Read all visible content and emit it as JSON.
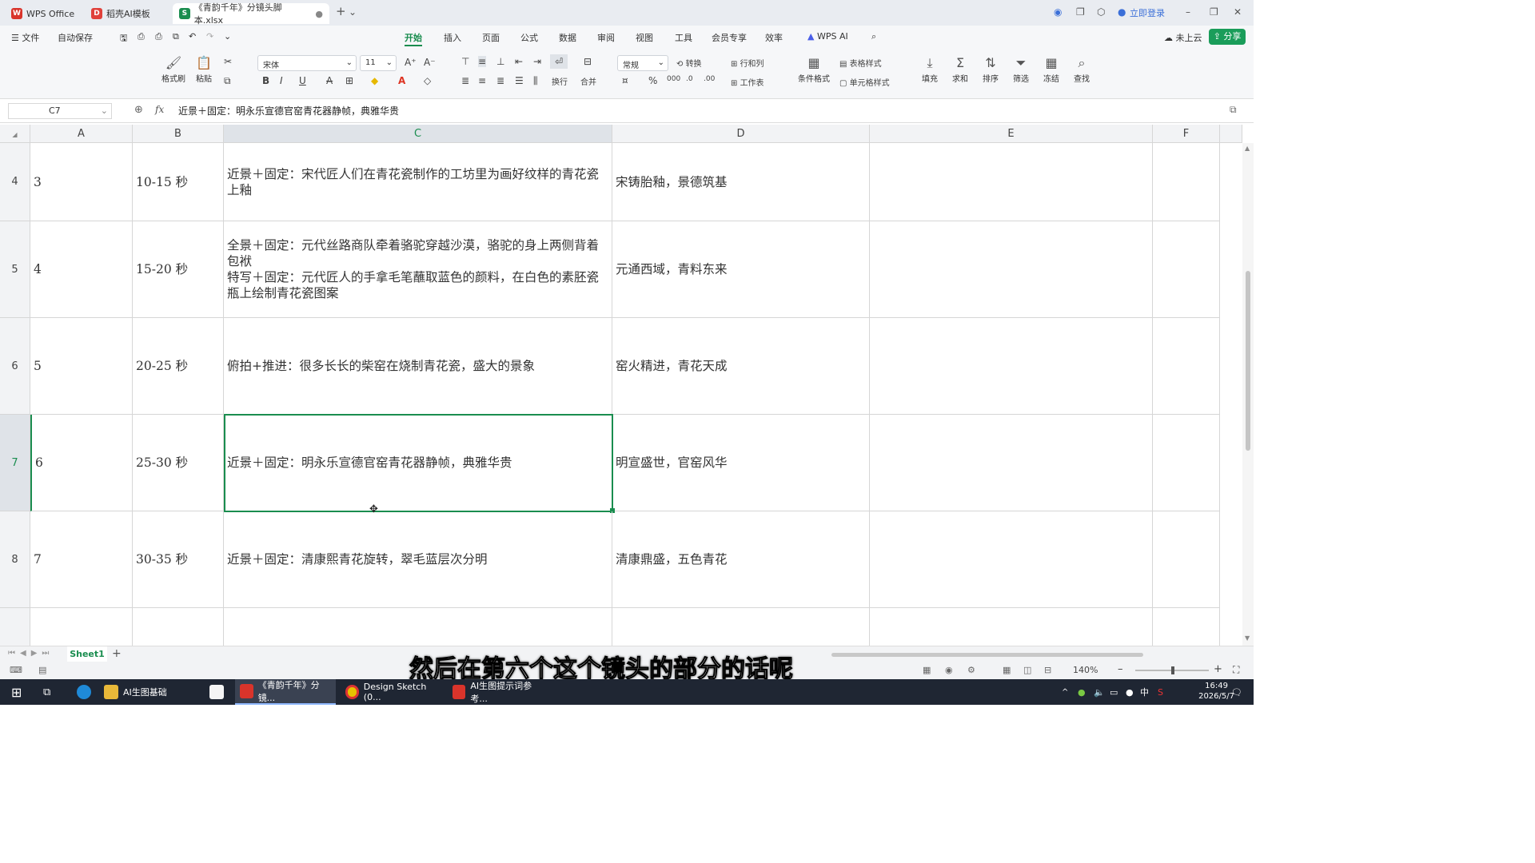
{
  "titlebar": {
    "tabs": [
      {
        "label": "WPS Office",
        "icon": "wps-icon"
      },
      {
        "label": "稻壳AI模板",
        "icon": "docer-icon"
      },
      {
        "label": "《青韵千年》分镜头脚本.xlsx",
        "icon": "sheet-icon"
      }
    ],
    "login": "立即登录"
  },
  "menubar": {
    "file": "文件",
    "autosave": "自动保存",
    "items": [
      "开始",
      "插入",
      "页面",
      "公式",
      "数据",
      "审阅",
      "视图",
      "工具",
      "会员专享",
      "效率"
    ],
    "wps_ai": "WPS AI",
    "cloud": "未上云",
    "share": "分享"
  },
  "ribbon": {
    "format_painter": "格式刷",
    "paste": "粘贴",
    "font": "宋体",
    "font_size": "11",
    "wrap": "换行",
    "merge": "合并",
    "number_format": "常规",
    "convert": "转换",
    "row_col": "行和列",
    "worksheet": "工作表",
    "cond_format": "条件格式",
    "table_style": "表格样式",
    "cell_style": "单元格样式",
    "fill": "填充",
    "sum": "求和",
    "sort": "排序",
    "filter": "筛选",
    "freeze": "冻结",
    "find": "查找"
  },
  "formulabar": {
    "cell_ref": "C7",
    "fx": "fx",
    "content": "近景＋固定：明永乐宣德官窑青花器静帧，典雅华贵"
  },
  "grid": {
    "columns": [
      "A",
      "B",
      "C",
      "D",
      "E",
      "F"
    ],
    "selected_column": "C",
    "rows": [
      {
        "num": "4",
        "a": "3",
        "b": "10-15 秒",
        "c": "近景＋固定：宋代匠人们在青花瓷制作的工坊里为画好纹样的青花瓷上釉",
        "d": "宋铸胎釉，景德筑基"
      },
      {
        "num": "5",
        "a": "4",
        "b": "15-20 秒",
        "c": "全景＋固定：元代丝路商队牵着骆驼穿越沙漠，骆驼的身上两侧背着包袱\n特写＋固定：元代匠人的手拿毛笔蘸取蓝色的颜料，在白色的素胚瓷瓶上绘制青花瓷图案",
        "d": "元通西域，青料东来"
      },
      {
        "num": "6",
        "a": "5",
        "b": "20-25 秒",
        "c": "俯拍+推进：很多长长的柴窑在烧制青花瓷，盛大的景象",
        "d": "窑火精进，青花天成"
      },
      {
        "num": "7",
        "a": "6",
        "b": "25-30 秒",
        "c": "近景＋固定：明永乐宣德官窑青花器静帧，典雅华贵",
        "d": "明宣盛世，官窑风华"
      },
      {
        "num": "8",
        "a": "7",
        "b": "30-35 秒",
        "c": "近景＋固定：清康熙青花旋转，翠毛蓝层次分明",
        "d": "清康鼎盛，五色青花"
      },
      {
        "num": "",
        "a": "",
        "b": "",
        "c": "",
        "d": ""
      }
    ]
  },
  "sheetbar": {
    "sheet": "Sheet1"
  },
  "statusbar": {
    "zoom": "140%"
  },
  "subtitle": "然后在第六个这个镜头的部分的话呢",
  "taskbar": {
    "items": [
      "AI生图基础",
      "《青韵千年》分镜...",
      "Design Sketch (0...",
      "AI生图提示词参考..."
    ],
    "time": "16:49",
    "date": "2026/5/7",
    "ime": "中"
  }
}
